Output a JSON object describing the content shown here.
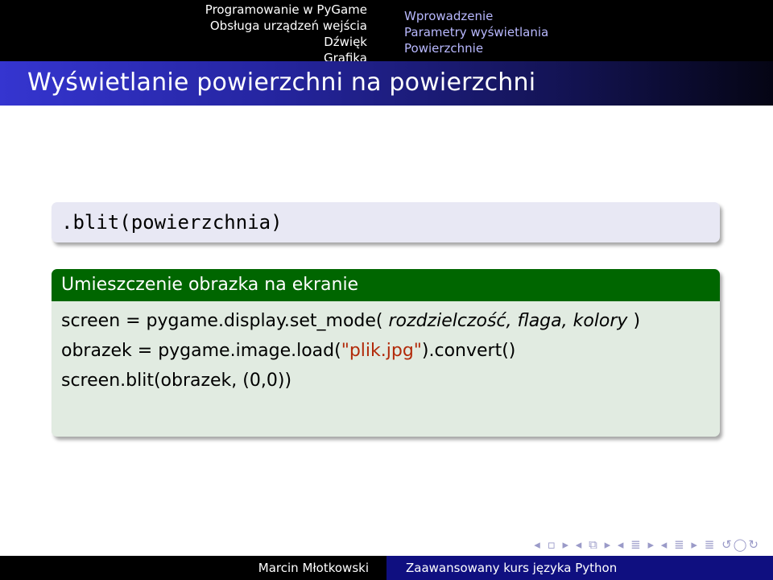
{
  "header": {
    "sections": [
      "Programowanie w PyGame",
      "Obsługa urządzeń wejścia",
      "Dźwięk",
      "Grafika"
    ],
    "subsections": [
      "Wprowadzenie",
      "Parametry wyświetlania",
      "Powierzchnie"
    ]
  },
  "frame_title": "Wyświetlanie powierzchni na powierzchni",
  "code_block": ".blit(powierzchnia)",
  "example": {
    "title": "Umieszczenie obrazka na ekranie",
    "line1": {
      "prefix": "screen = pygame.display.set_mode( ",
      "args": "rozdzielczość, flaga, kolory",
      "suffix": " )"
    },
    "line2": {
      "prefix": "obrazek = pygame.image.load(",
      "string": "\"plik.jpg\"",
      "suffix": ").convert()"
    },
    "line3": "screen.blit(obrazek, (0,0))"
  },
  "nav_symbols": "◂ ▫ ▸ ◂ ⧉ ▸ ◂ ≣ ▸ ◂ ≣ ▸ ≣ ↺◯↻",
  "footer": {
    "author": "Marcin Młotkowski",
    "course": "Zaawansowany kurs języka Python"
  },
  "colors": {
    "nav_background": "#000000",
    "subsection_text": "#b9b9ff",
    "title_gradient_start": "#3535d0",
    "example_header": "#006600",
    "example_body": "#e1ebe1",
    "code_block_bg": "#e8e8f4",
    "string_literal": "#b22a0a",
    "footer_right": "#0f0f80"
  }
}
